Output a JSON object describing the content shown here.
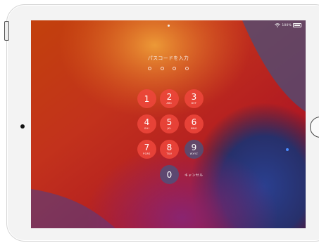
{
  "status_bar": {
    "battery_text": "100%"
  },
  "lock_screen": {
    "prompt": "パスコードを入力",
    "entered_digits": 0,
    "dot_count": 4,
    "keys": [
      {
        "number": "1",
        "letters": ""
      },
      {
        "number": "2",
        "letters": "ABC"
      },
      {
        "number": "3",
        "letters": "DEF"
      },
      {
        "number": "4",
        "letters": "GHI"
      },
      {
        "number": "5",
        "letters": "JKL"
      },
      {
        "number": "6",
        "letters": "MNO"
      },
      {
        "number": "7",
        "letters": "PQRS"
      },
      {
        "number": "8",
        "letters": "TUV"
      },
      {
        "number": "9",
        "letters": "WXYZ"
      },
      {
        "number": "0",
        "letters": ""
      }
    ],
    "cancel_label": "キャンセル"
  },
  "colors": {
    "key_red": "#ee463c",
    "key_dark": "#465582",
    "cursor_blue": "#4a8cff"
  }
}
